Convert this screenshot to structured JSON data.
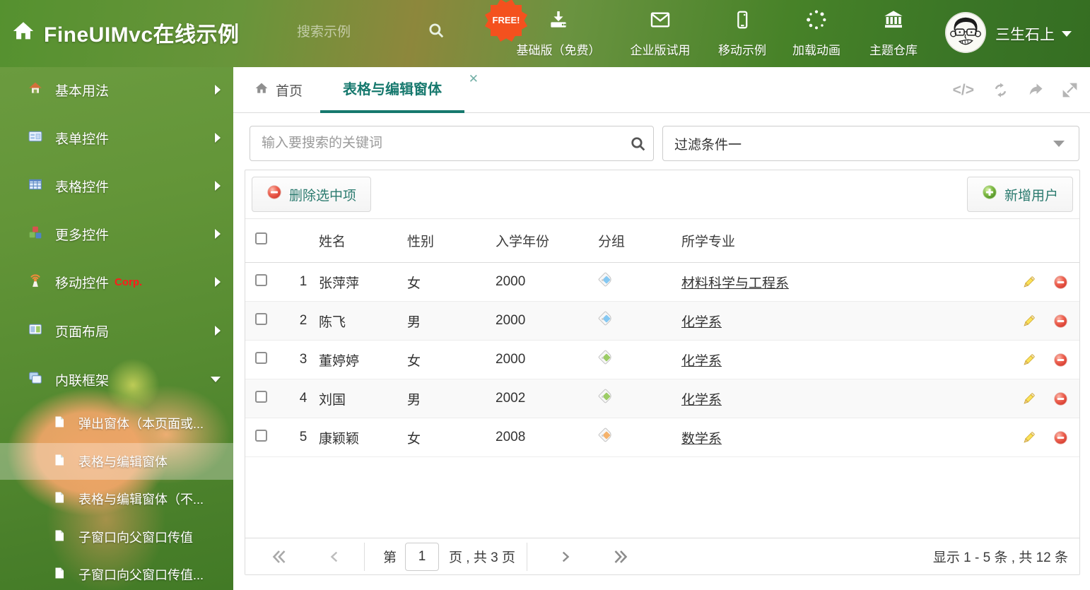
{
  "colors": {
    "accent": "#17796e",
    "header_green": "#55912f",
    "free_badge": "#f4511e",
    "tag_blue": "#85c8f2",
    "tag_green": "#9ccc65",
    "tag_orange": "#f5b26b",
    "corp_red": "#ff1a1a"
  },
  "header": {
    "title": "FineUIMvc在线示例",
    "search_placeholder": "搜索示例",
    "free_badge": "FREE!",
    "nav": [
      {
        "label": "基础版（免费）",
        "icon": "download-icon"
      },
      {
        "label": "企业版试用",
        "icon": "envelope-icon"
      },
      {
        "label": "移动示例",
        "icon": "mobile-icon"
      },
      {
        "label": "加载动画",
        "icon": "spinner-icon"
      },
      {
        "label": "主题仓库",
        "icon": "theme-repo-icon"
      }
    ],
    "username": "三生石上"
  },
  "sidebar": {
    "items": [
      {
        "label": "基本用法",
        "icon": "home-icon"
      },
      {
        "label": "表单控件",
        "icon": "form-icon"
      },
      {
        "label": "表格控件",
        "icon": "table-icon"
      },
      {
        "label": "更多控件",
        "icon": "cubes-icon"
      },
      {
        "label": "移动控件",
        "badge": "Corp.",
        "icon": "signal-icon"
      },
      {
        "label": "页面布局",
        "icon": "layout-icon"
      },
      {
        "label": "内联框架",
        "icon": "frames-icon",
        "expanded": true
      }
    ],
    "children": [
      {
        "label": "弹出窗体（本页面或..."
      },
      {
        "label": "表格与编辑窗体",
        "selected": true
      },
      {
        "label": "表格与编辑窗体（不..."
      },
      {
        "label": "子窗口向父窗口传值"
      },
      {
        "label": "子窗口向父窗口传值..."
      }
    ]
  },
  "tabs": {
    "home": "首页",
    "active": "表格与编辑窗体",
    "close": "✕"
  },
  "filter": {
    "search_placeholder": "输入要搜索的关键词",
    "dropdown_value": "过滤条件一"
  },
  "grid": {
    "delete_button": "删除选中项",
    "add_button": "新增用户",
    "columns": [
      "姓名",
      "性别",
      "入学年份",
      "分组",
      "所学专业"
    ],
    "rows": [
      {
        "num": "1",
        "name": "张萍萍",
        "gender": "女",
        "year": "2000",
        "tag_color": "#85c8f2",
        "major": "材料科学与工程系"
      },
      {
        "num": "2",
        "name": "陈飞",
        "gender": "男",
        "year": "2000",
        "tag_color": "#85c8f2",
        "major": "化学系"
      },
      {
        "num": "3",
        "name": "董婷婷",
        "gender": "女",
        "year": "2000",
        "tag_color": "#9ccc65",
        "major": "化学系"
      },
      {
        "num": "4",
        "name": "刘国",
        "gender": "男",
        "year": "2002",
        "tag_color": "#9ccc65",
        "major": "化学系"
      },
      {
        "num": "5",
        "name": "康颖颖",
        "gender": "女",
        "year": "2008",
        "tag_color": "#f5b26b",
        "major": "数学系"
      }
    ]
  },
  "pager": {
    "page_prefix": "第",
    "page": "1",
    "page_suffix": "页 , 共 3 页",
    "summary": "显示 1 - 5 条 , 共 12 条"
  }
}
